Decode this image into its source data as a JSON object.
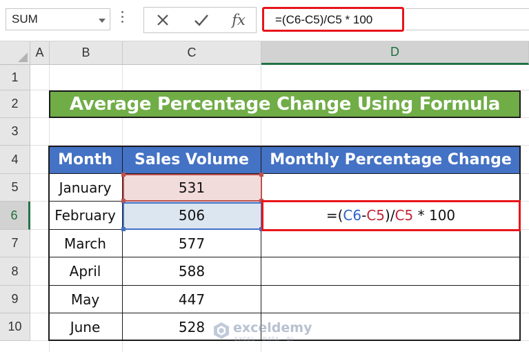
{
  "formula_bar": {
    "name_box": "SUM",
    "cancel_icon": "x-icon",
    "enter_icon": "check-icon",
    "fx_label": "fx",
    "formula": "=(C6-C5)/C5 * 100"
  },
  "columns": [
    "A",
    "B",
    "C",
    "D"
  ],
  "active_column": "D",
  "rows": [
    "1",
    "2",
    "3",
    "4",
    "5",
    "6",
    "7",
    "8",
    "9",
    "10"
  ],
  "active_row": "6",
  "title": "Average Percentage Change Using Formula",
  "table": {
    "headers": [
      "Month",
      "Sales Volume",
      "Monthly Percentage Change"
    ],
    "rows": [
      {
        "month": "January",
        "sales": "531",
        "change": ""
      },
      {
        "month": "February",
        "sales": "506",
        "change": ""
      },
      {
        "month": "March",
        "sales": "577",
        "change": ""
      },
      {
        "month": "April",
        "sales": "588",
        "change": ""
      },
      {
        "month": "May",
        "sales": "447",
        "change": ""
      },
      {
        "month": "June",
        "sales": "528",
        "change": ""
      }
    ]
  },
  "editing_cell": {
    "parts": [
      "=(",
      "C6",
      "-",
      "C5",
      ")/",
      "C5",
      " * 100"
    ]
  },
  "colors": {
    "title_bg": "#70ad47",
    "header_bg": "#4472c4",
    "highlight_red": "#e8141a",
    "ref_blue": "#2e61c7",
    "ref_red": "#c0253a"
  },
  "watermark": {
    "name": "exceldemy",
    "tagline": "EXCEL · DATA · BI"
  }
}
